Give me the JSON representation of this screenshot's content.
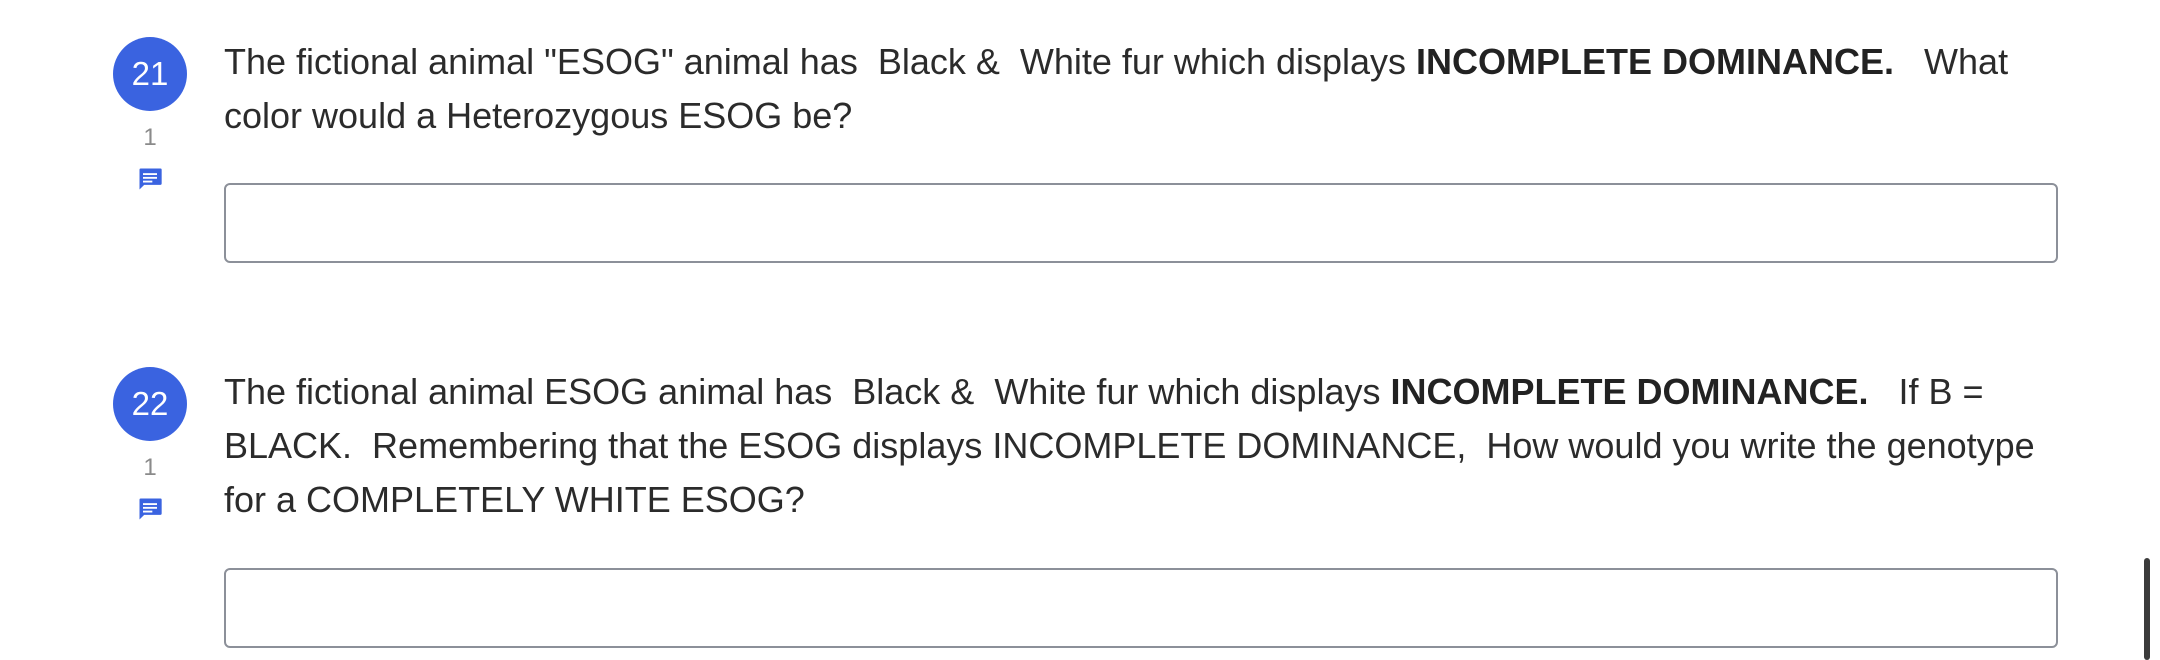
{
  "questions": [
    {
      "number": "21",
      "comment_count": "1",
      "icon": "comment-icon",
      "text_parts": {
        "a": "The fictional animal \"ESOG\" animal has  Black &  White fur which displays ",
        "b": "INCOMPLETE DOMINANCE.",
        "c": "   What color would a Heterozygous ESOG be?"
      },
      "answer_value": ""
    },
    {
      "number": "22",
      "comment_count": "1",
      "icon": "comment-icon",
      "text_parts": {
        "a": "The fictional animal ESOG animal has  Black &  White fur which displays ",
        "b": "INCOMPLETE DOMINANCE.",
        "c": "   If B = BLACK.  Remembering that the ESOG displays INCOMPLETE DOMINANCE,  How would you write the genotype for a COMPLETELY WHITE ESOG?"
      },
      "answer_value": ""
    }
  ],
  "colors": {
    "accent": "#3a63e0",
    "text": "#2b2b2b",
    "muted": "#8a8a8a",
    "input_border": "#8c9099"
  }
}
